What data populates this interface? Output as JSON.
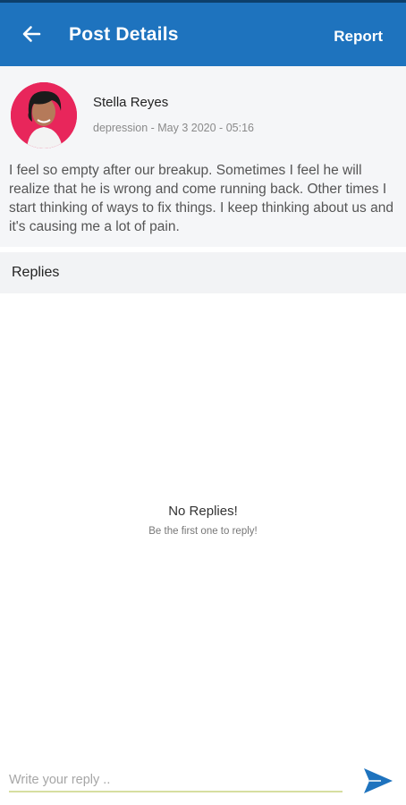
{
  "header": {
    "title": "Post Details",
    "report_label": "Report",
    "back_icon": "arrow-left-icon",
    "color": "#1e73be"
  },
  "post": {
    "author": "Stella Reyes",
    "meta": "depression - May 3 2020 - 05:16",
    "body": "I feel so empty after our breakup. Sometimes I feel he will realize that he is wrong and come running back. Other times I start thinking of ways to fix things. I keep thinking about us and it's causing me a lot of pain.",
    "avatar_accent": "#e8265b"
  },
  "replies": {
    "label": "Replies",
    "empty_title": "No Replies!",
    "empty_subtitle": "Be the first one to reply!"
  },
  "composer": {
    "placeholder": "Write your reply ..",
    "value": "",
    "send_icon": "send-icon"
  }
}
